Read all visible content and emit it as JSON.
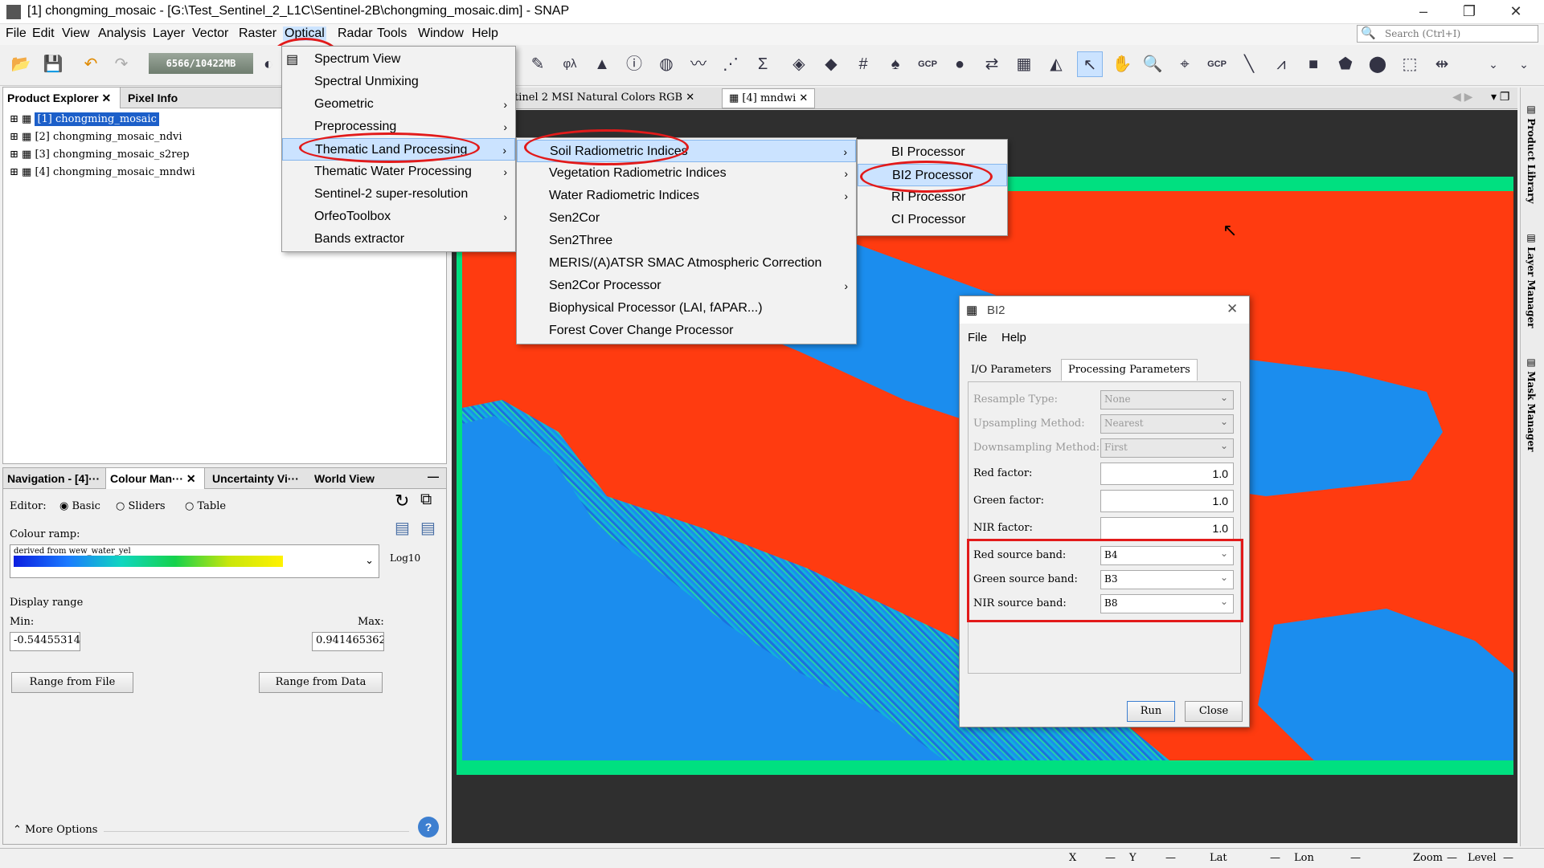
{
  "window": {
    "title": "[1] chongming_mosaic - [G:\\Test_Sentinel_2_L1C\\Sentinel-2B\\chongming_mosaic.dim] - SNAP",
    "minimize": "–",
    "maximize": "❐",
    "close": "✕"
  },
  "menubar": {
    "items": [
      "File",
      "Edit",
      "View",
      "Analysis",
      "Layer",
      "Vector",
      "Raster",
      "Optical",
      "Radar",
      "Tools",
      "Window",
      "Help"
    ],
    "search_placeholder": "Search (Ctrl+I)"
  },
  "toolbar": {
    "memory": "6566/10422MB",
    "gcp1": "GCP",
    "gcp2": "GCP"
  },
  "product_explorer": {
    "tabs": [
      "Product Explorer",
      "Pixel Info"
    ],
    "items": [
      "[1] chongming_mosaic",
      "[2] chongming_mosaic_ndvi",
      "[3] chongming_mosaic_s2rep",
      "[4] chongming_mosaic_mndwi"
    ]
  },
  "bottom_panel": {
    "tabs": [
      "Navigation - [4]···",
      "Colour Man···",
      "Uncertainty Vi···",
      "World View"
    ],
    "editor_label": "Editor:",
    "editor_options": [
      "Basic",
      "Sliders",
      "Table"
    ],
    "colour_ramp_label": "Colour ramp:",
    "ramp_name": "derived from wew_water_yel",
    "log_label": "Log10",
    "display_range": "Display range",
    "min_label": "Min:",
    "max_label": "Max:",
    "min_value": "-0.54455314",
    "max_value": "0.941465362",
    "range_file": "Range from File",
    "range_data": "Range from Data",
    "more_options": "More Options"
  },
  "doc_tabs": {
    "tab1": "tinel 2 MSI Natural Colors RGB",
    "tab2": "[4] mndwi"
  },
  "right_sidebar": [
    "Product Library",
    "Layer Manager",
    "Mask Manager"
  ],
  "optical_menu": [
    "Spectrum View",
    "Spectral Unmixing",
    "Geometric",
    "Preprocessing",
    "Thematic Land Processing",
    "Thematic Water Processing",
    "Sentinel-2 super-resolution",
    "OrfeoToolbox",
    "Bands extractor"
  ],
  "thematic_menu": [
    "Soil Radiometric Indices",
    "Vegetation Radiometric Indices",
    "Water Radiometric Indices",
    "Sen2Cor",
    "Sen2Three",
    "MERIS/(A)ATSR SMAC Atmospheric Correction",
    "Sen2Cor Processor",
    "Biophysical Processor (LAI, fAPAR...)",
    "Forest Cover Change Processor"
  ],
  "soil_menu": [
    "BI Processor",
    "BI2 Processor",
    "RI Processor",
    "CI Processor"
  ],
  "dialog": {
    "title": "BI2",
    "menu": [
      "File",
      "Help"
    ],
    "tabs": [
      "I/O Parameters",
      "Processing Parameters"
    ],
    "params": [
      {
        "label": "Resample Type:",
        "value": "None",
        "kind": "select-disabled"
      },
      {
        "label": "Upsampling Method:",
        "value": "Nearest",
        "kind": "select-disabled"
      },
      {
        "label": "Downsampling Method:",
        "value": "First",
        "kind": "select-disabled"
      },
      {
        "label": "Red factor:",
        "value": "1.0",
        "kind": "number"
      },
      {
        "label": "Green factor:",
        "value": "1.0",
        "kind": "number"
      },
      {
        "label": "NIR factor:",
        "value": "1.0",
        "kind": "number"
      },
      {
        "label": "Red source band:",
        "value": "B4",
        "kind": "select"
      },
      {
        "label": "Green source band:",
        "value": "B3",
        "kind": "select"
      },
      {
        "label": "NIR source band:",
        "value": "B8",
        "kind": "select"
      }
    ],
    "run": "Run",
    "close": "Close"
  },
  "statusbar": {
    "x": "X",
    "y": "Y",
    "lat": "Lat",
    "lon": "Lon",
    "zoom": "Zoom",
    "level": "Level",
    "dash": "—"
  },
  "colors": {
    "highlight": "#e21a1a",
    "water": "#ff3b10",
    "land": "#1b8dee"
  }
}
